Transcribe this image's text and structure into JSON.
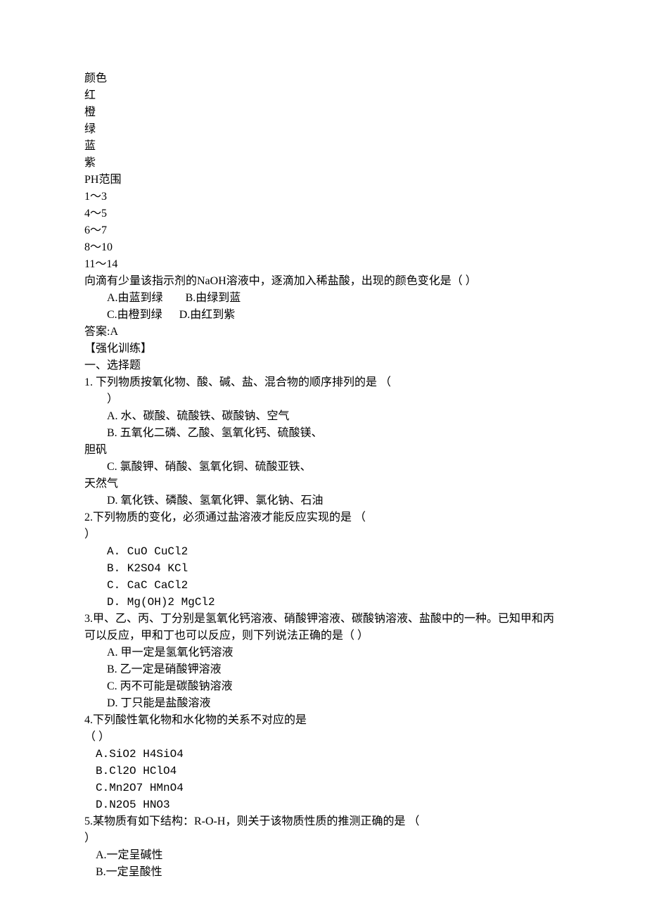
{
  "color_table": {
    "header": "颜色",
    "colors": [
      "红",
      "橙",
      "绿",
      "蓝",
      "紫"
    ],
    "ph_header": "PH范围",
    "ph_ranges": [
      "1～3",
      "4～5",
      "6～7",
      "8～10",
      "11～14"
    ]
  },
  "intro_question": {
    "stem": "向滴有少量该指示剂的NaOH溶液中，逐滴加入稀盐酸，出现的颜色变化是（       ）",
    "option_a": "A.由蓝到绿",
    "option_b": "B.由绿到蓝",
    "option_c": "C.由橙到绿",
    "option_d": "D.由红到紫",
    "answer": "答案:A"
  },
  "section_header": "【强化训练】",
  "part1_header": "一、选择题",
  "q1": {
    "stem_a": "1.  下列物质按氧化物、酸、碱、盐、混合物的顺序排列的是                  （    ",
    "stem_b": "）",
    "opt_a": "A.  水、碳酸、硫酸铁、碳酸钠、空气",
    "opt_b": "B.  五氧化二磷、乙酸、氢氧化钙、硫酸镁、",
    "opt_b2": "胆矾",
    "opt_c": "C.  氯酸钾、硝酸、氢氧化铜、硫酸亚铁、",
    "opt_c2": "天然气",
    "opt_d": "D.  氧化铁、磷酸、氢氧化钾、氯化钠、石油"
  },
  "q2": {
    "stem_a": "2.下列物质的变化，必须通过盐溶液才能反应实现的是                      （    ",
    "stem_b": "）",
    "opt_a": "A.  CuO     CuCl2",
    "opt_b": "B.  K2SO4       KCl",
    "opt_c": "C.  CaC      CaCl2",
    "opt_d": "D.  Mg(OH)2        MgCl2"
  },
  "q3": {
    "stem": "3.甲、乙、丙、丁分别是氢氧化钙溶液、硝酸钾溶液、碳酸钠溶液、盐酸中的一种。已知甲和丙可以反应，甲和丁也可以反应，则下列说法正确的是（      ）",
    "opt_a": "A.  甲一定是氢氧化钙溶液",
    "opt_b": "B.  乙一定是硝酸钾溶液",
    "opt_c": "C.  丙不可能是碳酸钠溶液",
    "opt_d": "D.  丁只能是盐酸溶液"
  },
  "q4": {
    "stem_a": "4.下列酸性氧化物和水化物的关系不对应的是                             ",
    "stem_b": "（         ）",
    "opt_a": "A.SiO2   H4SiO4",
    "opt_b": "B.Cl2O   HClO4",
    "opt_c": "C.Mn2O7  HMnO4",
    "opt_d": "D.N2O5   HNO3"
  },
  "q5": {
    "stem_a": "5.某物质有如下结构：R-O-H，则关于该物质性质的推测正确的是              （    ",
    "stem_b": "）",
    "opt_a": "A.一定呈碱性",
    "opt_b": "B.一定呈酸性"
  }
}
